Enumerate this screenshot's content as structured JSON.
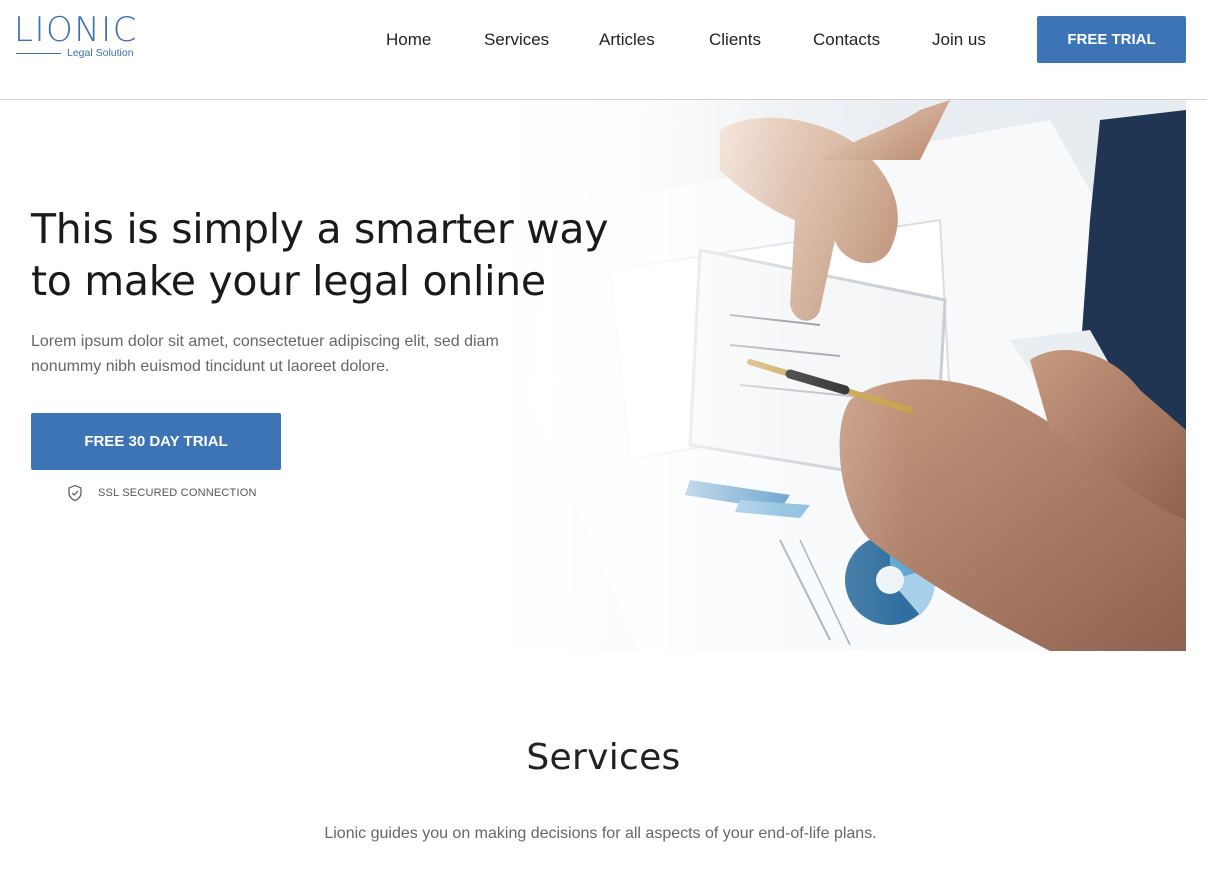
{
  "brand": {
    "name": "LIONIC",
    "tagline": "Legal Solution",
    "color": "#3b6fb0"
  },
  "nav": {
    "items": [
      {
        "label": "Home"
      },
      {
        "label": "Services"
      },
      {
        "label": "Articles"
      },
      {
        "label": "Clients"
      },
      {
        "label": "Contacts"
      },
      {
        "label": "Join us"
      }
    ],
    "cta_label": "FREE TRIAL"
  },
  "hero": {
    "title_line1": "This is simply a smarter way",
    "title_line2": "to make your legal online",
    "description": "Lorem ipsum dolor sit amet, consectetuer adipiscing elit, sed diam nonummy nibh euismod tincidunt ut laoreet dolore.",
    "cta_label": "FREE 30 DAY TRIAL",
    "ssl_icon": "shield-check-icon",
    "ssl_text": "SSL SECURED CONNECTION",
    "image": "business-hands-documents-pen-photo"
  },
  "services": {
    "title": "Services",
    "description": "Lionic guides you on making decisions for all aspects of your end-of-life plans."
  },
  "colors": {
    "accent": "#3d74b6",
    "text_muted": "#666666"
  }
}
